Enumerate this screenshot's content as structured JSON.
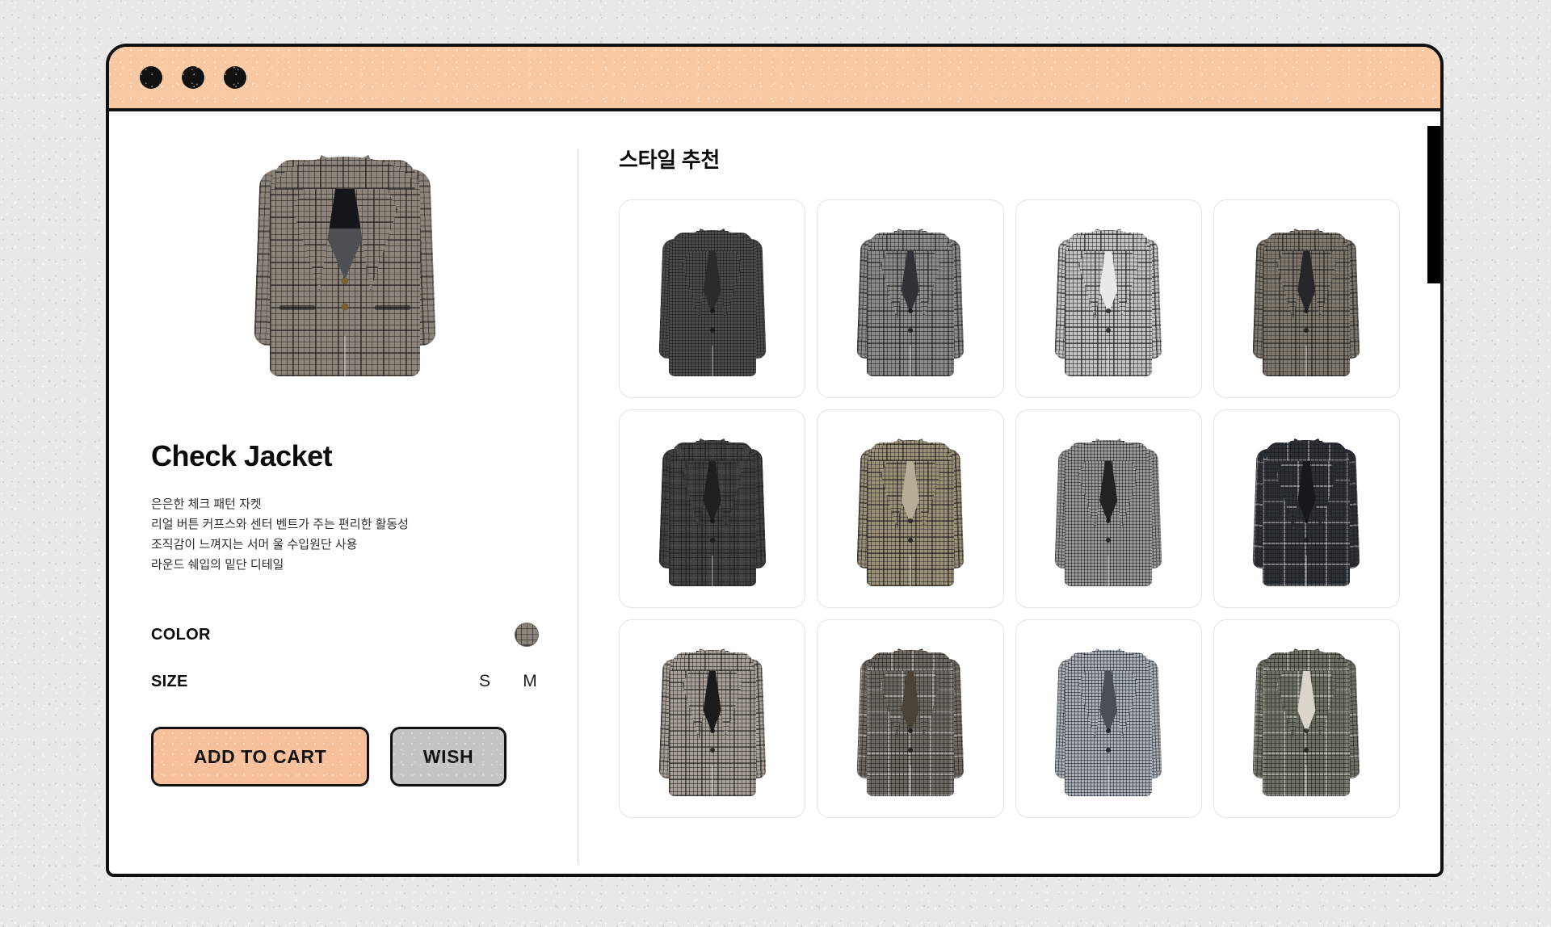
{
  "window": {
    "dots": [
      "close-dot",
      "minimize-dot",
      "maximize-dot"
    ],
    "title_bar_color": "#f8c9a3",
    "border_color": "#111111"
  },
  "product": {
    "title": "Check Jacket",
    "image_alt": "check-pattern-jacket",
    "description_lines": [
      "은은한 체크 패턴 자켓",
      "리얼 버튼 커프스와 센터 벤트가 주는 편리한 활동성",
      "조직감이 느껴지는 서머 울 수입원단 사용",
      "라운드 쉐입의 밑단 디테일"
    ],
    "options": {
      "color": {
        "label": "COLOR",
        "swatches": [
          {
            "name": "check-grey",
            "hex": "#8d857c"
          }
        ]
      },
      "size": {
        "label": "SIZE",
        "values": [
          "S",
          "M"
        ]
      }
    },
    "actions": {
      "add_to_cart": "ADD TO CART",
      "wish": "WISH",
      "cart_color": "#f8c09a",
      "wish_color": "#c4c4c4"
    }
  },
  "recommendations": {
    "title": "스타일 추천",
    "items": [
      {
        "name": "charcoal-micro-check-jacket",
        "base": "#4b4b4b",
        "weave": "fine",
        "lining": "#2b2b2b"
      },
      {
        "name": "grey-glen-plaid-jacket",
        "base": "#8c8c8c",
        "weave": "glen",
        "lining": "#2f3338"
      },
      {
        "name": "light-grey-check-jacket",
        "base": "#c3c3c3",
        "weave": "glen",
        "lining": "#e9e9e9"
      },
      {
        "name": "brown-grey-glen-check-jacket",
        "base": "#82796e",
        "weave": "glen",
        "lining": "#26262a"
      },
      {
        "name": "dark-charcoal-plaid-jacket",
        "base": "#3f3f3f",
        "weave": "glen",
        "lining": "#1f1f1f"
      },
      {
        "name": "taupe-beige-check-jacket",
        "base": "#9b9078",
        "weave": "glen",
        "lining": "#b5ad95"
      },
      {
        "name": "mid-grey-check-jacket",
        "base": "#9a9a9a",
        "weave": "fine",
        "lining": "#222222"
      },
      {
        "name": "navy-black-windowpane-jacket",
        "base": "#2b2f36",
        "weave": "pane",
        "lining": "#15181c"
      },
      {
        "name": "light-beige-glen-check-jacket",
        "base": "#a9a097",
        "weave": "glen",
        "lining": "#1b1b1b"
      },
      {
        "name": "grey-brown-plaid-jacket",
        "base": "#6d6860",
        "weave": "pane",
        "lining": "#4a4236"
      },
      {
        "name": "pale-blue-grey-check-jacket",
        "base": "#aab2bb",
        "weave": "fine",
        "lining": "#4a4f55"
      },
      {
        "name": "olive-windowpane-jacket",
        "base": "#6e7163",
        "weave": "pane",
        "lining": "#d8d6cb"
      }
    ],
    "columns": 4
  },
  "scrollbar": {
    "orientation": "vertical",
    "thumb_color": "#000000",
    "position": "right"
  }
}
